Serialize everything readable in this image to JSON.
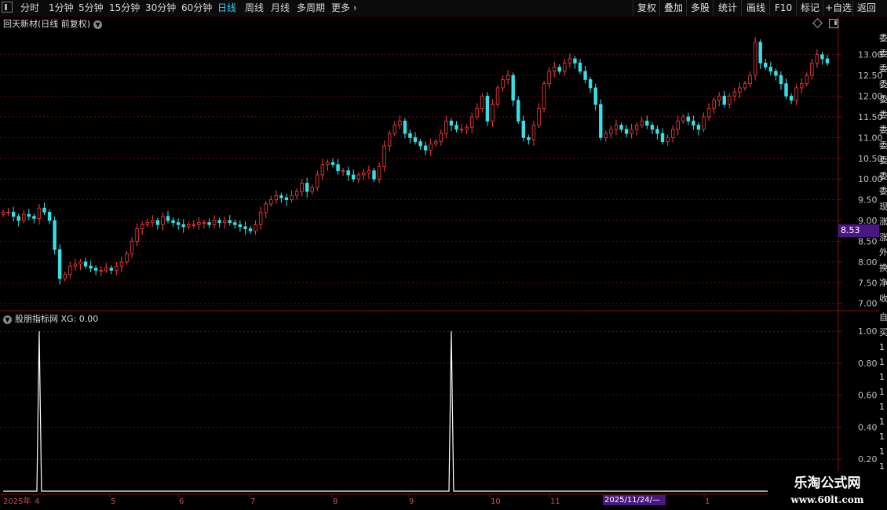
{
  "toolbar": {
    "periods": [
      "分时",
      "1分钟",
      "5分钟",
      "15分钟",
      "30分钟",
      "60分钟",
      "日线",
      "周线",
      "月线",
      "多周期",
      "更多"
    ],
    "active_period": "日线",
    "right_buttons": [
      "复权",
      "叠加",
      "多股",
      "统计",
      "画线",
      "F10",
      "标记",
      "+自选",
      "返回"
    ]
  },
  "main_chart": {
    "title": "回天新材(日线 前复权)",
    "y_ticks": [
      "13.00",
      "12.50",
      "12.00",
      "11.50",
      "11.00",
      "10.50",
      "10.00",
      "9.50",
      "9.00",
      "8.50",
      "8.00",
      "7.50",
      "7.00"
    ],
    "current_price": "8.53"
  },
  "indicator": {
    "title": "股朋指标网 XG: 0.00",
    "y_ticks": [
      "1.00",
      "0.80",
      "0.60",
      "0.40",
      "0.20"
    ]
  },
  "x_axis": {
    "labels": [
      "2025年",
      "4",
      "5",
      "6",
      "7",
      "8",
      "9",
      "10",
      "11",
      "1"
    ],
    "cursor_date": "2025/11/24/—"
  },
  "watermark": {
    "line1": "乐淘公式网",
    "line2": "www.60lt.com"
  },
  "side_panel_chars": [
    "委",
    "委",
    "委",
    "委",
    "委",
    "委",
    "委",
    "委",
    "委",
    "委",
    "委",
    "现",
    "涨",
    "涨",
    "外",
    "换",
    "净",
    "收"
  ],
  "side_panel_chars_lower": [
    "自",
    "买",
    "1",
    "1",
    "1",
    "1",
    "1",
    "1",
    "1",
    "1",
    "1",
    "1",
    "1"
  ],
  "colors": {
    "up": "#ff3d3d",
    "down": "#36e0e6",
    "grid": "#7a1414",
    "active": "#37d3ff",
    "price_tag": "#4a1780"
  },
  "chart_data": {
    "type": "candlestick",
    "y_range": [
      6.9,
      13.6
    ],
    "indicator_range": [
      0,
      1.05
    ],
    "indicator_signals": [
      {
        "index": 7,
        "value": 1.0
      },
      {
        "index": 87,
        "value": 1.0
      }
    ],
    "close": [
      9.2,
      9.2,
      9.1,
      9.0,
      9.15,
      9.1,
      9.05,
      9.3,
      9.2,
      9.0,
      8.3,
      7.6,
      7.7,
      7.9,
      7.95,
      8.0,
      7.9,
      7.85,
      7.8,
      7.8,
      7.85,
      7.8,
      7.9,
      8.0,
      8.2,
      8.5,
      8.8,
      8.9,
      8.95,
      9.0,
      8.9,
      9.1,
      9.0,
      8.95,
      8.9,
      8.85,
      8.9,
      8.9,
      8.95,
      8.95,
      8.9,
      9.0,
      8.95,
      9.0,
      8.95,
      8.9,
      8.85,
      8.8,
      8.75,
      8.9,
      9.2,
      9.4,
      9.5,
      9.6,
      9.55,
      9.5,
      9.6,
      9.7,
      9.9,
      9.7,
      9.8,
      10.1,
      10.35,
      10.4,
      10.35,
      10.2,
      10.2,
      10.1,
      10.0,
      10.1,
      10.15,
      10.2,
      10.0,
      10.3,
      10.8,
      11.1,
      11.3,
      11.4,
      11.1,
      11.0,
      10.9,
      10.8,
      10.7,
      10.85,
      10.9,
      11.1,
      11.4,
      11.3,
      11.2,
      11.2,
      11.25,
      11.5,
      11.7,
      12.0,
      11.4,
      11.8,
      12.2,
      12.4,
      12.5,
      11.9,
      11.4,
      11.0,
      10.95,
      11.3,
      11.7,
      12.3,
      12.6,
      12.7,
      12.6,
      12.8,
      12.9,
      12.8,
      12.6,
      12.4,
      12.2,
      11.8,
      11.0,
      11.1,
      11.2,
      11.3,
      11.2,
      11.1,
      11.2,
      11.3,
      11.4,
      11.3,
      11.2,
      11.1,
      10.9,
      11.0,
      11.2,
      11.4,
      11.5,
      11.4,
      11.3,
      11.2,
      11.5,
      11.7,
      11.9,
      12.0,
      11.8,
      12.0,
      12.1,
      12.2,
      12.3,
      12.5,
      13.3,
      12.8,
      12.7,
      12.6,
      12.5,
      12.3,
      12.0,
      11.9,
      12.2,
      12.3,
      12.5,
      12.8,
      13.0,
      12.9,
      12.8
    ]
  }
}
